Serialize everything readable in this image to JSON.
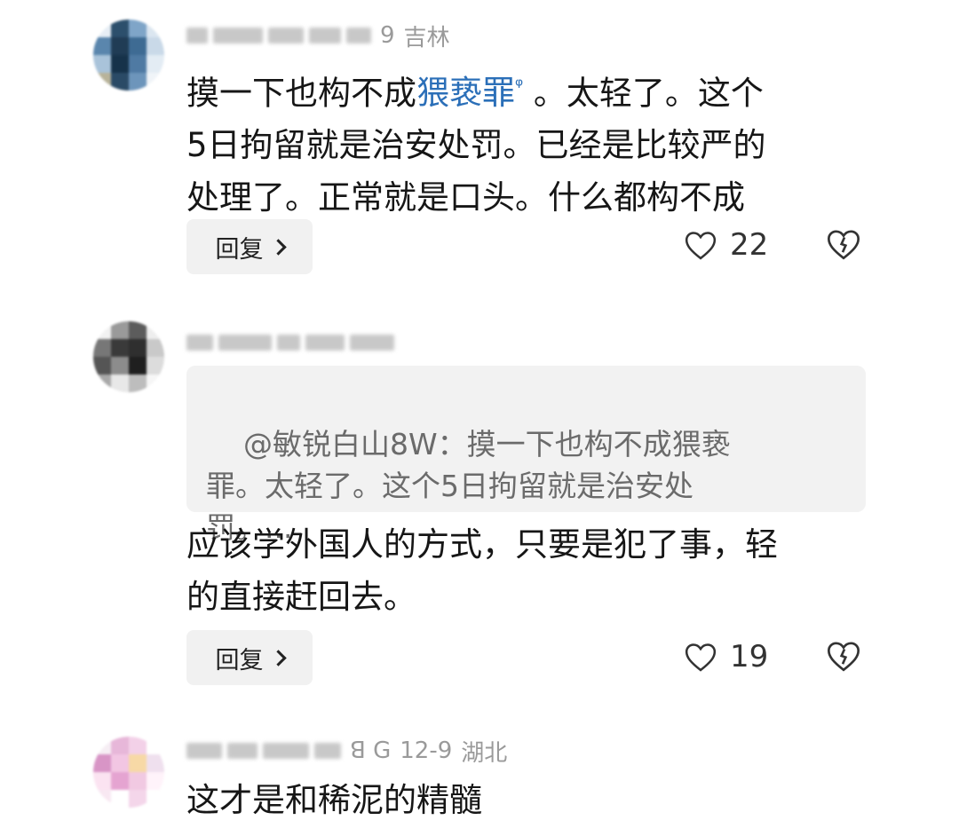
{
  "comments": [
    {
      "location": "吉林",
      "meta_tail": "9",
      "text_before": "摸一下也构不成",
      "mention": "猥亵罪",
      "text_after": " 。太轻了。这个\n5日拘留就是治安处罚。已经是比较严的\n处理了。正常就是口头。什么都构不成",
      "reply_label": "回复",
      "likes": "22",
      "avatar_colors": [
        "#e7eef5",
        "#2c4f6c",
        "#7fa5c8",
        "#dbe6f0",
        "#5a86ad",
        "#203c55",
        "#3e6b93",
        "#c9d9e8",
        "#a9c3da",
        "#16324a",
        "#4f7aa3",
        "#e3ecf4",
        "#b8b39a",
        "#2a4a66",
        "#6d95bb",
        "#f0f4f8"
      ]
    },
    {
      "quote": "@敏锐白山8W：摸一下也构不成猥亵\n罪。太轻了。这个5日拘留就是治安处\n罚。...",
      "text": "应该学外国人的方式，只要是犯了事，轻\n的直接赶回去。",
      "reply_label": "回复",
      "likes": "19",
      "avatar_colors": [
        "#f2f2f2",
        "#9a9a9a",
        "#5c5c5c",
        "#eeeeee",
        "#777777",
        "#3a3a3a",
        "#2f2f2f",
        "#c9c9c9",
        "#555555",
        "#8c8c8c",
        "#1f1f1f",
        "#dcdcdc",
        "#a8a8a8",
        "#e8e8e8",
        "#bdbdbd",
        "#f6f6f6"
      ]
    },
    {
      "meta_prefix": "ꓭ G",
      "date": "12-9",
      "location": "湖北",
      "text": "这才是和稀泥的精髓",
      "avatar_colors": [
        "#f6eef4",
        "#e7b7d9",
        "#f3d1e8",
        "#ffffff",
        "#d895c6",
        "#f2c6e3",
        "#f7d9a6",
        "#efe0ee",
        "#fbe3f1",
        "#e5a4d1",
        "#f1c9e2",
        "#fff3fa",
        "#f8e8f2",
        "#ffffff",
        "#f4d6ea",
        "#ffffff"
      ]
    }
  ],
  "colors": {
    "mention": "#2b6fb8",
    "meta": "#9a9a9a",
    "quote_bg": "#f2f2f2"
  }
}
